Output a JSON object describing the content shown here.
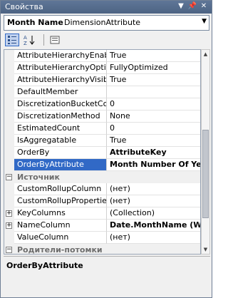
{
  "window": {
    "title": "Свойства"
  },
  "object_selector": {
    "name": "Month Name",
    "type": "DimensionAttribute"
  },
  "toolbar": {
    "buttons": [
      "categorized-icon",
      "alphabetical-icon",
      "property-pages-icon"
    ]
  },
  "properties": [
    {
      "name": "AttributeHierarchyEnabled",
      "value": "True"
    },
    {
      "name": "AttributeHierarchyOptimizedState",
      "value": "FullyOptimized"
    },
    {
      "name": "AttributeHierarchyVisible",
      "value": "True"
    },
    {
      "name": "DefaultMember",
      "value": ""
    },
    {
      "name": "DiscretizationBucketCount",
      "value": "0"
    },
    {
      "name": "DiscretizationMethod",
      "value": "None"
    },
    {
      "name": "EstimatedCount",
      "value": "0"
    },
    {
      "name": "IsAggregatable",
      "value": "True"
    },
    {
      "name": "OrderBy",
      "value": "AttributeKey"
    },
    {
      "name": "OrderByAttribute",
      "value": "Month Number Of Year"
    }
  ],
  "source_category": {
    "label": "Источник"
  },
  "source_properties": [
    {
      "name": "CustomRollupColumn",
      "value": "(нет)"
    },
    {
      "name": "CustomRollupPropertiesColumn",
      "value": "(нет)"
    },
    {
      "name": "KeyColumns",
      "value": "(Collection)"
    },
    {
      "name": "NameColumn",
      "value": "Date.MonthName (WChar)"
    },
    {
      "name": "ValueColumn",
      "value": "(нет)"
    }
  ],
  "parent_child_category": {
    "label": "Родители-потомки"
  },
  "description": {
    "title": "OrderByAttribute"
  },
  "colors": {
    "selection": "#3169c6",
    "titlebar": "#5f7697"
  }
}
